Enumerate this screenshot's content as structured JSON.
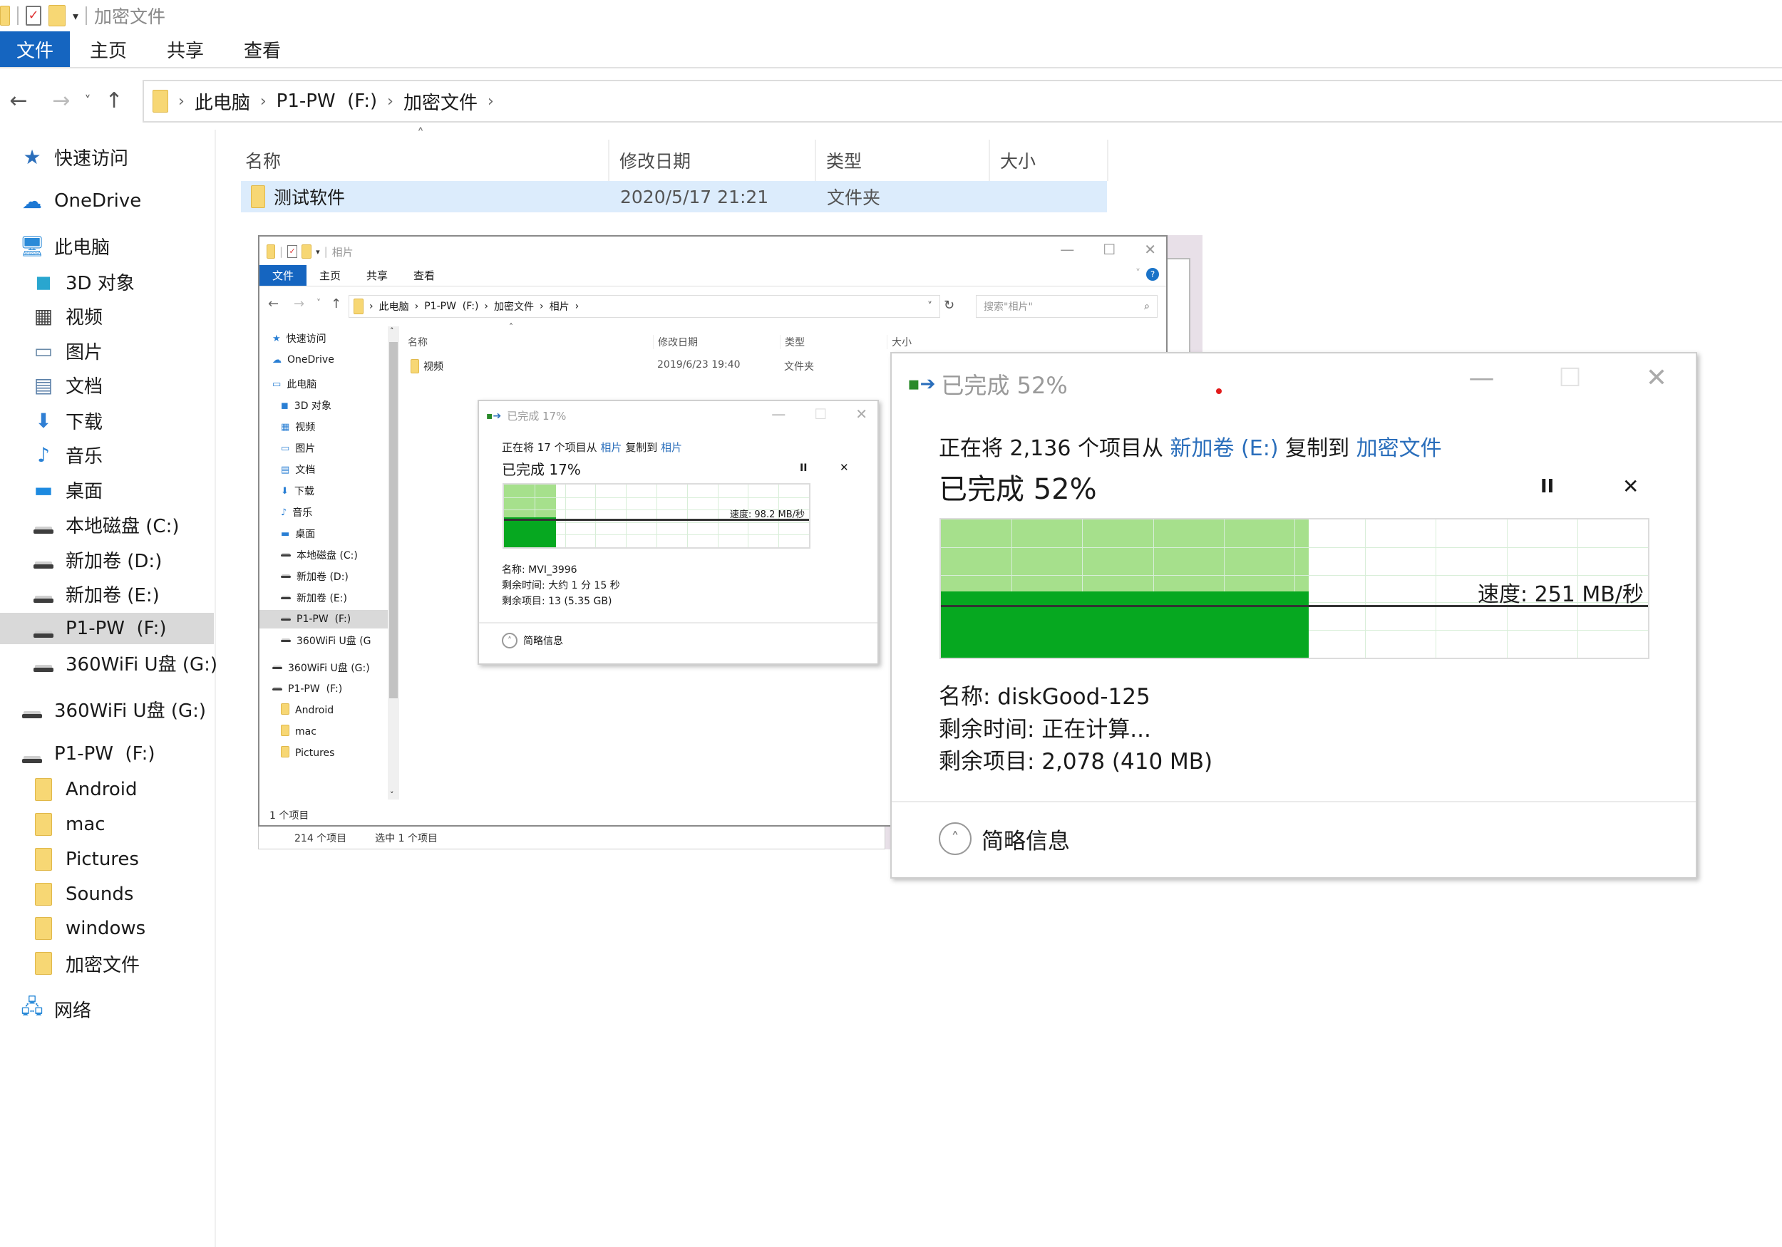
{
  "main_window": {
    "title": "加密文件",
    "ribbon_tabs": [
      "文件",
      "主页",
      "共享",
      "查看"
    ],
    "nav": {
      "back": "←",
      "forward": "→",
      "recent": "˅",
      "up": "↑"
    },
    "breadcrumb": [
      "此电脑",
      "P1-PW  (F:)",
      "加密文件"
    ],
    "sidebar": {
      "items": [
        {
          "label": "快速访问",
          "icon": "star-icon"
        },
        {
          "label": "OneDrive",
          "icon": "cloud-icon"
        },
        {
          "label": "此电脑",
          "icon": "computer-icon"
        },
        {
          "label": "3D 对象",
          "icon": "cube-icon"
        },
        {
          "label": "视频",
          "icon": "video-icon"
        },
        {
          "label": "图片",
          "icon": "picture-icon"
        },
        {
          "label": "文档",
          "icon": "document-icon"
        },
        {
          "label": "下载",
          "icon": "download-icon"
        },
        {
          "label": "音乐",
          "icon": "music-icon"
        },
        {
          "label": "桌面",
          "icon": "desktop-icon"
        },
        {
          "label": "本地磁盘 (C:)",
          "icon": "system-drive-icon"
        },
        {
          "label": "新加卷 (D:)",
          "icon": "drive-icon"
        },
        {
          "label": "新加卷 (E:)",
          "icon": "drive-icon"
        },
        {
          "label": "P1-PW  (F:)",
          "icon": "drive-icon",
          "selected": true
        },
        {
          "label": "360WiFi U盘 (G:)",
          "icon": "drive-icon"
        },
        {
          "label": "360WiFi U盘 (G:)",
          "icon": "drive-icon"
        },
        {
          "label": "P1-PW  (F:)",
          "icon": "drive-icon"
        },
        {
          "label": "Android",
          "icon": "folder-icon"
        },
        {
          "label": "mac",
          "icon": "folder-icon"
        },
        {
          "label": "Pictures",
          "icon": "folder-icon"
        },
        {
          "label": "Sounds",
          "icon": "folder-icon"
        },
        {
          "label": "windows",
          "icon": "folder-icon"
        },
        {
          "label": "加密文件",
          "icon": "folder-icon"
        },
        {
          "label": "网络",
          "icon": "network-icon"
        }
      ]
    },
    "columns": [
      "名称",
      "修改日期",
      "类型",
      "大小"
    ],
    "rows": [
      {
        "name": "测试软件",
        "modified": "2020/5/17 21:21",
        "type": "文件夹",
        "size": ""
      }
    ]
  },
  "inner_window": {
    "title": "相片",
    "ribbon_tabs": [
      "文件",
      "主页",
      "共享",
      "查看"
    ],
    "breadcrumb": [
      "此电脑",
      "P1-PW  (F:)",
      "加密文件",
      "相片"
    ],
    "search_placeholder": "搜索\"相片\"",
    "sidebar": [
      "快速访问",
      "OneDrive",
      "此电脑",
      "3D 对象",
      "视频",
      "图片",
      "文档",
      "下载",
      "音乐",
      "桌面",
      "本地磁盘 (C:)",
      "新加卷 (D:)",
      "新加卷 (E:)",
      "P1-PW  (F:)",
      "360WiFi U盘 (G",
      "360WiFi U盘 (G:)",
      "P1-PW  (F:)",
      "Android",
      "mac",
      "Pictures"
    ],
    "columns": [
      "名称",
      "修改日期",
      "类型",
      "大小"
    ],
    "rows": [
      {
        "name": "视频",
        "modified": "2019/6/23 19:40",
        "type": "文件夹",
        "size": ""
      }
    ],
    "status": "1 个项目",
    "back_window_status": [
      "214 个项目",
      "选中 1 个项目"
    ]
  },
  "copy_dialog_small": {
    "title": "已完成 17%",
    "line_prefix": "正在将 17 个项目从",
    "source": "相片",
    "mid": "复制到",
    "dest": "相片",
    "progress_label": "已完成 17%",
    "progress_percent": 17,
    "speed_label": "速度: 98.2 MB/秒",
    "name": "名称: MVI_3996",
    "time_left": "剩余时间: 大约 1 分 15 秒",
    "items_left": "剩余项目: 13 (5.35 GB)",
    "details_toggle": "简略信息",
    "pause": "II",
    "cancel": "✕"
  },
  "copy_dialog_large": {
    "title": "已完成 52%",
    "line_prefix": "正在将 2,136 个项目从",
    "source": "新加卷 (E:)",
    "mid": "复制到",
    "dest": "加密文件",
    "progress_label": "已完成 52%",
    "progress_percent": 52,
    "speed_label": "速度: 251 MB/秒",
    "name": "名称: diskGood-125",
    "time_left": "剩余时间: 正在计算...",
    "items_left": "剩余项目: 2,078 (410 MB)",
    "details_toggle": "简略信息",
    "pause": "II",
    "cancel": "✕"
  },
  "colors": {
    "ribbon_active": "#1565c0",
    "selection": "#dcecfc",
    "progress_done": "#a6e08c",
    "speed_fill": "#06a820",
    "link": "#2a6ebb"
  }
}
